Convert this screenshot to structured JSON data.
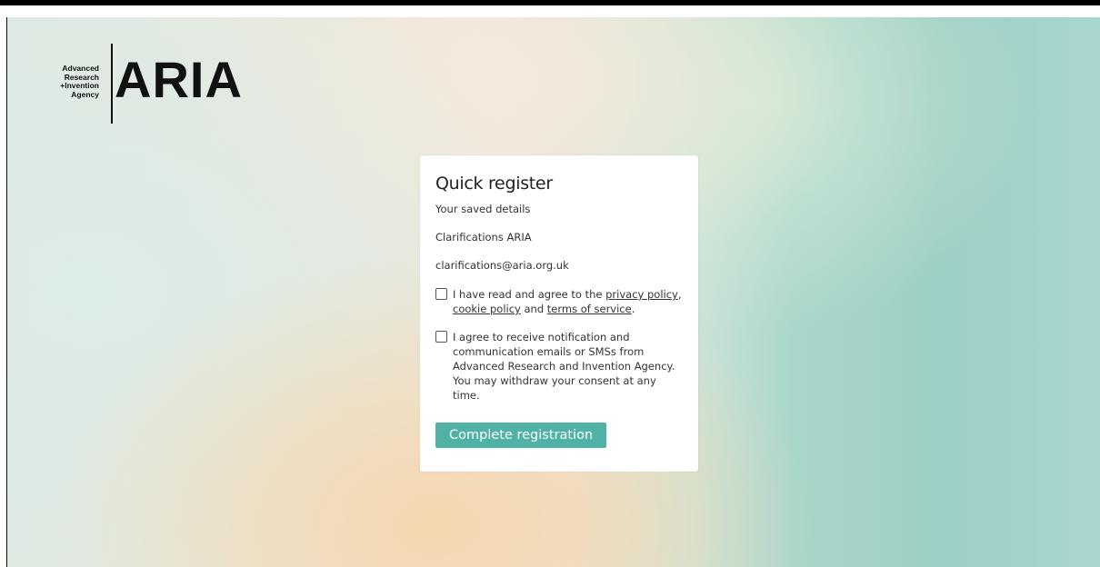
{
  "brand": {
    "logo_small_text": "Advanced\nResearch\n+Invention\nAgency",
    "logo_big_text": "ARIA"
  },
  "card": {
    "title": "Quick register",
    "subtitle": "Your saved details",
    "name": "Clarifications ARIA",
    "email": "clarifications@aria.org.uk",
    "consent_privacy": {
      "prefix": "I have read and agree to the ",
      "privacy_link": "privacy policy",
      "comma": ",",
      "cookie_link": "cookie policy",
      "and": " and ",
      "terms_link": "terms of service",
      "suffix": ".",
      "checked": false
    },
    "consent_comms": {
      "text": "I agree to receive notification and communication emails or SMSs from Advanced Research and Invention Agency. You may withdraw your consent at any time.",
      "checked": false
    },
    "submit_label": "Complete registration"
  },
  "colors": {
    "accent": "#4fb2a5",
    "card_bg": "#ffffff"
  }
}
